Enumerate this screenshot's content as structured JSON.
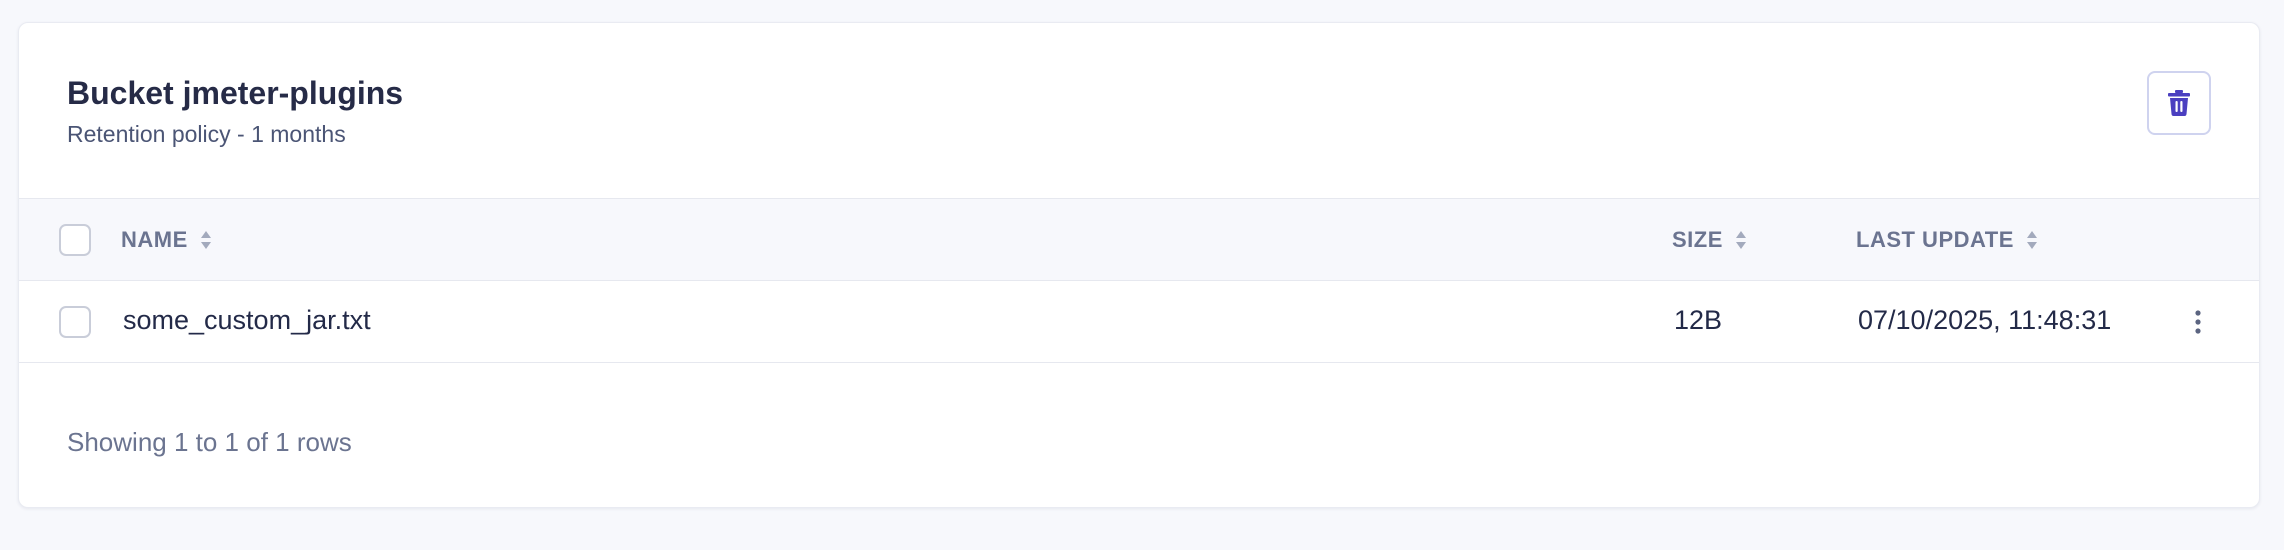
{
  "bucket": {
    "title": "Bucket jmeter-plugins",
    "subtitle": "Retention policy - 1 months"
  },
  "toolbar": {
    "delete_icon": "trash-icon"
  },
  "table": {
    "columns": [
      {
        "key": "name",
        "label": "NAME"
      },
      {
        "key": "size",
        "label": "SIZE"
      },
      {
        "key": "last_update",
        "label": "LAST UPDATE"
      }
    ],
    "rows": [
      {
        "name": "some_custom_jar.txt",
        "size": "12B",
        "last_update": "07/10/2025, 11:48:31"
      }
    ]
  },
  "footer": {
    "pagination_text": "Showing 1 to 1 of 1 rows"
  },
  "colors": {
    "accent": "#4b3fc0",
    "border": "#e6e8ef",
    "header_bg": "#f7f8fc"
  }
}
